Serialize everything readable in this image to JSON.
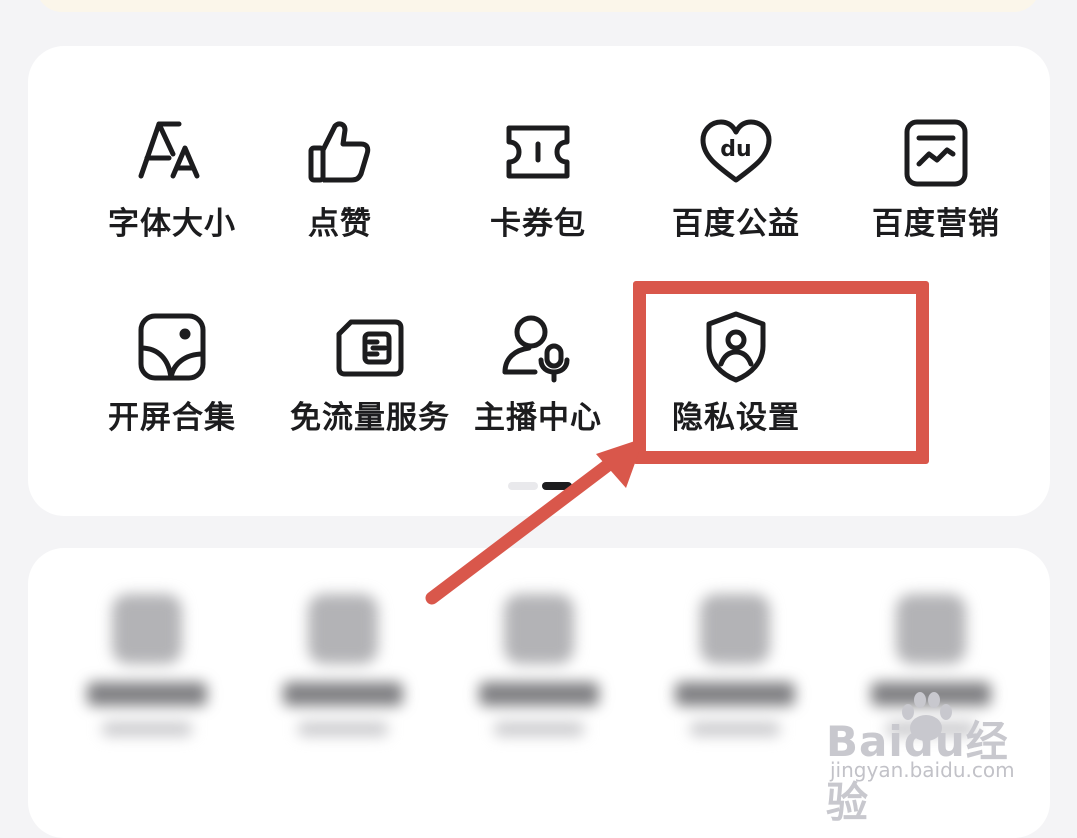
{
  "grid_items": [
    {
      "label": "字体大小",
      "icon": "font-size-icon"
    },
    {
      "label": "点赞",
      "icon": "thumbs-up-icon"
    },
    {
      "label": "卡券包",
      "icon": "ticket-icon"
    },
    {
      "label": "百度公益",
      "icon": "heart-du-icon"
    },
    {
      "label": "百度营销",
      "icon": "chart-card-icon"
    },
    {
      "label": "开屏合集",
      "icon": "picture-icon"
    },
    {
      "label": "免流量服务",
      "icon": "sim-card-icon"
    },
    {
      "label": "主播中心",
      "icon": "anchor-mic-icon"
    },
    {
      "label": "隐私设置",
      "icon": "privacy-shield-icon"
    }
  ],
  "pager": {
    "pages": 2,
    "active": 2
  },
  "annotation": {
    "highlight_color": "#d9574b",
    "target": "隐私设置"
  },
  "watermark": {
    "logo_text": "Baidu经验",
    "url": "jingyan.baidu.com"
  }
}
